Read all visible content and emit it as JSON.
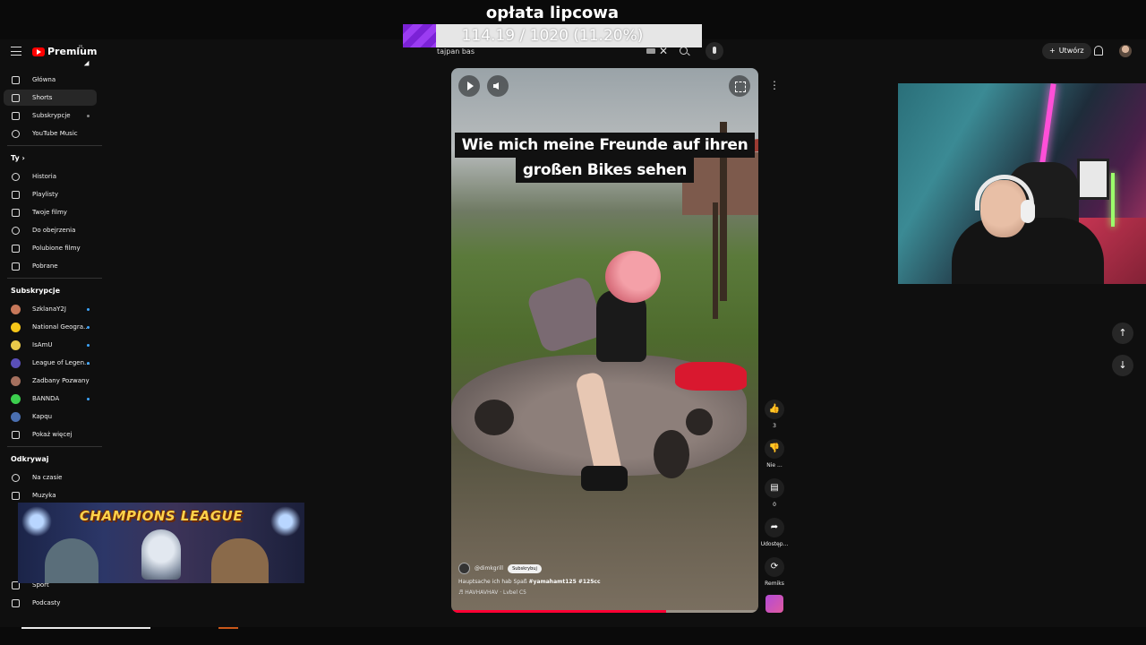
{
  "stream_goal": {
    "title": "opłata lipcowa",
    "progress_text": "114.19 / 1020 (11.20%)",
    "progress_fraction": 0.112,
    "fill_color": "#7b22d6"
  },
  "masthead": {
    "logo_text": "Premium",
    "logo_sup": "PL",
    "search_value": "tajpan bas",
    "create_label": "Utwórz"
  },
  "sidebar": {
    "main": [
      {
        "label": "Główna",
        "icon": "home-icon"
      },
      {
        "label": "Shorts",
        "icon": "shorts-icon"
      },
      {
        "label": "Subskrypcje",
        "icon": "subscriptions-icon"
      },
      {
        "label": "YouTube Music",
        "icon": "music-icon"
      }
    ],
    "you_header": "Ty",
    "you": [
      {
        "label": "Historia",
        "icon": "history-icon"
      },
      {
        "label": "Playlisty",
        "icon": "playlists-icon"
      },
      {
        "label": "Twoje filmy",
        "icon": "your-videos-icon"
      },
      {
        "label": "Do obejrzenia",
        "icon": "watch-later-icon"
      },
      {
        "label": "Polubione filmy",
        "icon": "liked-icon"
      },
      {
        "label": "Pobrane",
        "icon": "downloads-icon"
      }
    ],
    "subs_header": "Subskrypcje",
    "subs": [
      {
        "label": "SzklanaY2J",
        "color": "#c7785a"
      },
      {
        "label": "National Geogra...",
        "color": "#f5c518"
      },
      {
        "label": "IsAmU",
        "color": "#e8c84a"
      },
      {
        "label": "League of Legen...",
        "color": "#5a4fb8"
      },
      {
        "label": "Zadbany Pozwany",
        "color": "#a5705e"
      },
      {
        "label": "BANNDA",
        "color": "#3ccf4e"
      },
      {
        "label": "Kapqu",
        "color": "#4a6fb0"
      }
    ],
    "show_more": "Pokaż więcej",
    "explore_header": "Odkrywaj",
    "explore": [
      {
        "label": "Na czasie",
        "icon": "trending-icon"
      },
      {
        "label": "Muzyka",
        "icon": "music-note-icon"
      },
      {
        "label": "Sport",
        "icon": "trophy-icon"
      },
      {
        "label": "Podcasty",
        "icon": "podcast-icon"
      }
    ]
  },
  "short": {
    "caption_line1": "Wie mich meine Freunde auf ihren",
    "caption_line2": "großen Bikes sehen",
    "channel": "@dimkgrill",
    "subscribe_label": "Subskrybuj",
    "title_plain": "Hauptsache ich hab Spaß ",
    "title_tags": "#yamahamt125 #125cc",
    "sound": "HAVHAVHAV · Lvbel C5",
    "progress_fraction": 0.7
  },
  "actions": {
    "like_count": "3",
    "dislike_label": "Nie ...",
    "comments_count": "0",
    "share_label": "Udostęp...",
    "remix_label": "Remiks"
  },
  "overlay": {
    "banner_title": "CHAMPIONS LEAGUE"
  }
}
